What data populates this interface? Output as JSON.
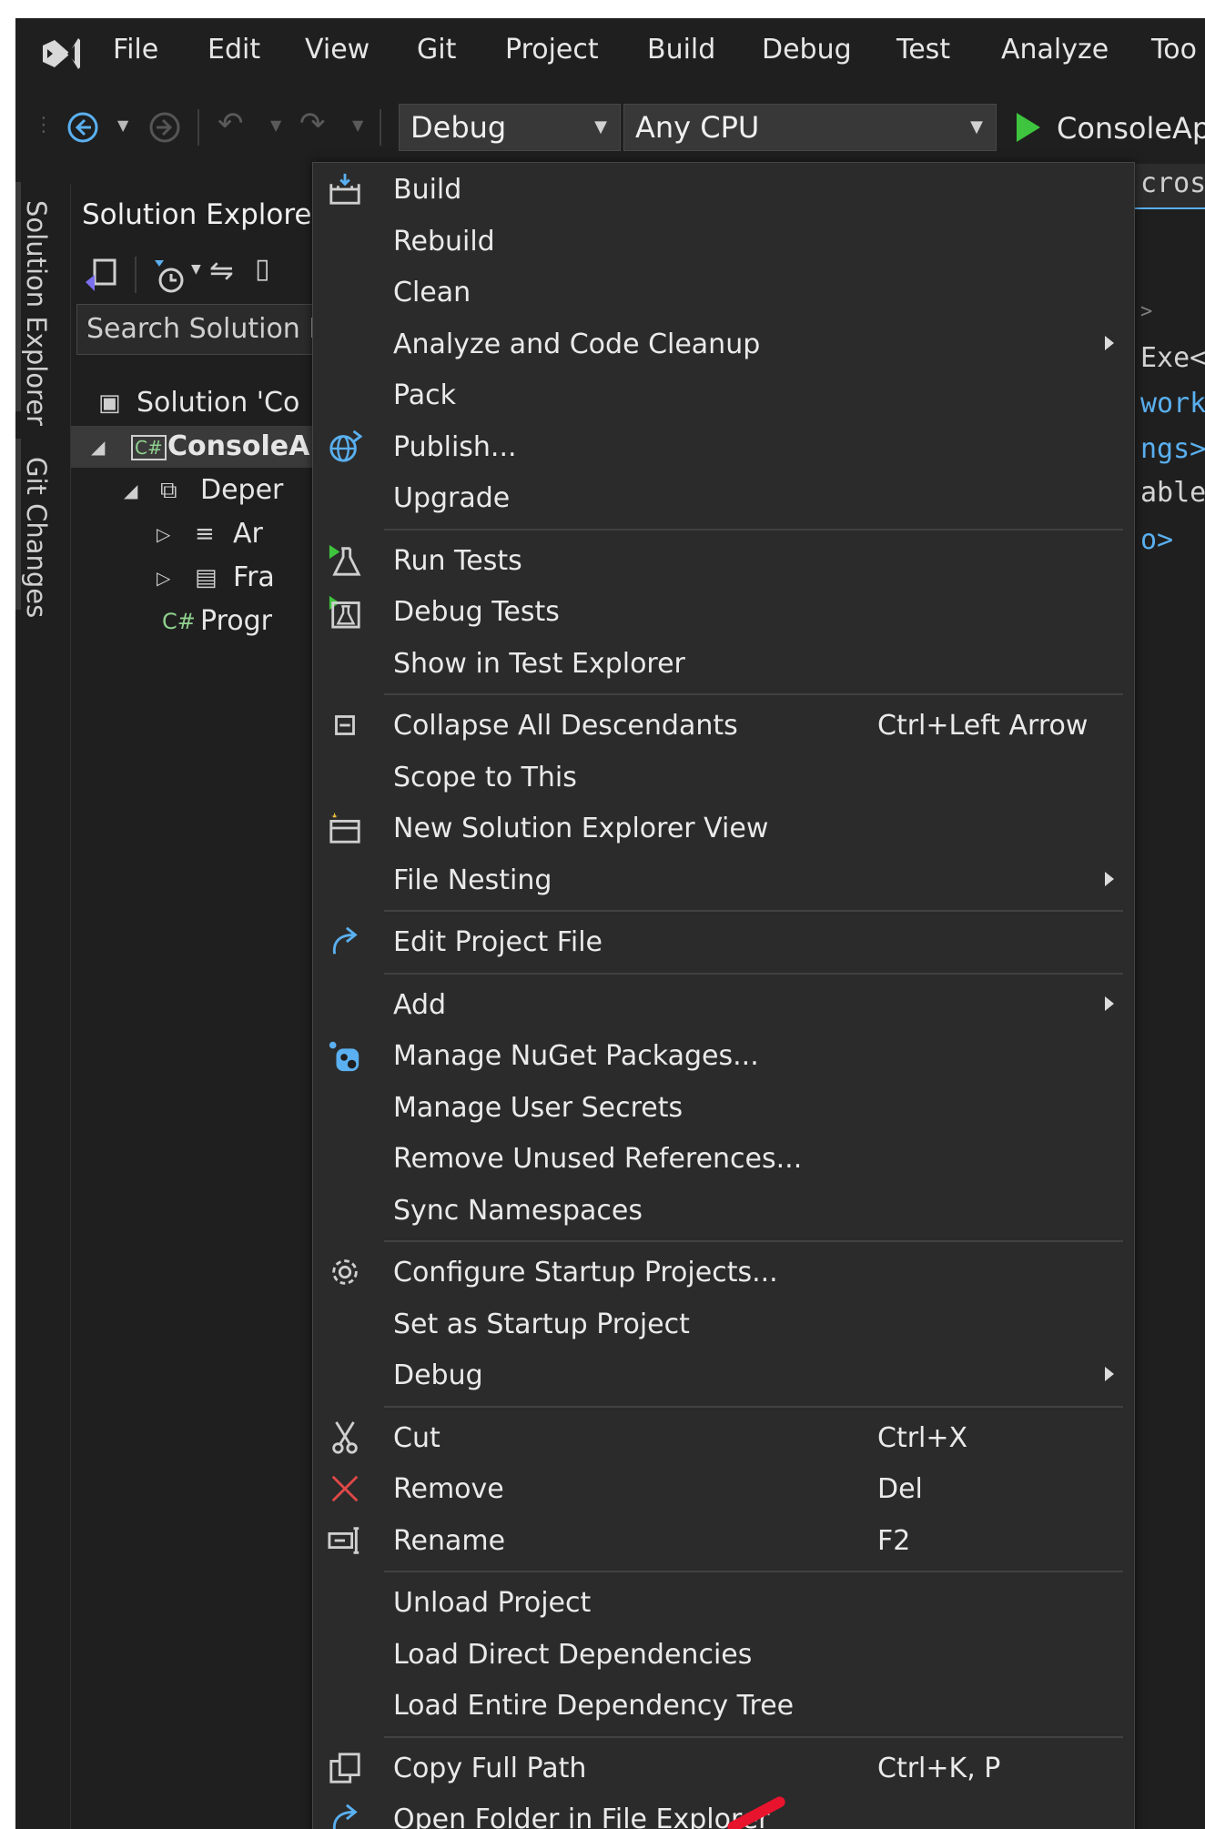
{
  "menubar": {
    "items": [
      "File",
      "Edit",
      "View",
      "Git",
      "Project",
      "Build",
      "Debug",
      "Test",
      "Analyze",
      "Too"
    ]
  },
  "toolbar": {
    "config_value": "Debug",
    "platform_value": "Any CPU",
    "run_label": "ConsoleAp",
    "accent_play": "#3ec43e"
  },
  "side_tabs": [
    "Solution Explorer",
    "Git Changes"
  ],
  "solution_explorer": {
    "title": "Solution Explorer",
    "search_placeholder": "Search Solution E",
    "tree": [
      {
        "label": "Solution 'Co",
        "kind": "solution"
      },
      {
        "label": "ConsoleA",
        "kind": "project",
        "selected": true
      },
      {
        "label": "Deper",
        "kind": "dependencies"
      },
      {
        "label": "Ar",
        "kind": "analyzers"
      },
      {
        "label": "Fra",
        "kind": "frameworks"
      },
      {
        "label": "Progr",
        "kind": "csharp-file"
      }
    ]
  },
  "editor_fragments": [
    "cros",
    ">",
    "Exe<",
    "work",
    "ngs>",
    "able",
    "o>"
  ],
  "context_menu": {
    "groups": [
      [
        {
          "label": "Build",
          "icon": "build-icon"
        },
        {
          "label": "Rebuild"
        },
        {
          "label": "Clean"
        },
        {
          "label": "Analyze and Code Cleanup",
          "submenu": true
        },
        {
          "label": "Pack"
        },
        {
          "label": "Publish...",
          "icon": "globe-icon"
        },
        {
          "label": "Upgrade"
        }
      ],
      [
        {
          "label": "Run Tests",
          "icon": "run-tests-icon"
        },
        {
          "label": "Debug Tests",
          "icon": "debug-tests-icon"
        },
        {
          "label": "Show in Test Explorer"
        }
      ],
      [
        {
          "label": "Collapse All Descendants",
          "shortcut": "Ctrl+Left Arrow",
          "icon": "collapse-icon"
        },
        {
          "label": "Scope to This"
        },
        {
          "label": "New Solution Explorer View",
          "icon": "new-view-icon"
        },
        {
          "label": "File Nesting",
          "submenu": true
        }
      ],
      [
        {
          "label": "Edit Project File",
          "icon": "edit-arrow-icon"
        }
      ],
      [
        {
          "label": "Add",
          "submenu": true
        },
        {
          "label": "Manage NuGet Packages...",
          "icon": "nuget-icon"
        },
        {
          "label": "Manage User Secrets"
        },
        {
          "label": "Remove Unused References..."
        },
        {
          "label": "Sync Namespaces"
        }
      ],
      [
        {
          "label": "Configure Startup Projects...",
          "icon": "gear-icon"
        },
        {
          "label": "Set as Startup Project"
        },
        {
          "label": "Debug",
          "submenu": true
        }
      ],
      [
        {
          "label": "Cut",
          "shortcut": "Ctrl+X",
          "icon": "scissors-icon"
        },
        {
          "label": "Remove",
          "shortcut": "Del",
          "icon": "remove-icon"
        },
        {
          "label": "Rename",
          "shortcut": "F2",
          "icon": "rename-icon"
        }
      ],
      [
        {
          "label": "Unload Project"
        },
        {
          "label": "Load Direct Dependencies"
        },
        {
          "label": "Load Entire Dependency Tree"
        }
      ],
      [
        {
          "label": "Copy Full Path",
          "shortcut": "Ctrl+K, P",
          "icon": "copy-icon"
        },
        {
          "label": "Open Folder in File Explorer",
          "icon": "open-folder-arrow-icon"
        }
      ]
    ]
  },
  "colors": {
    "background": "#1f1f1f",
    "menu_background": "#2b2b2b",
    "accent": "#7b6ff0",
    "icon_blue": "#5ab0f0",
    "remove_red": "#e04848",
    "annotation_red": "#e8142d"
  }
}
